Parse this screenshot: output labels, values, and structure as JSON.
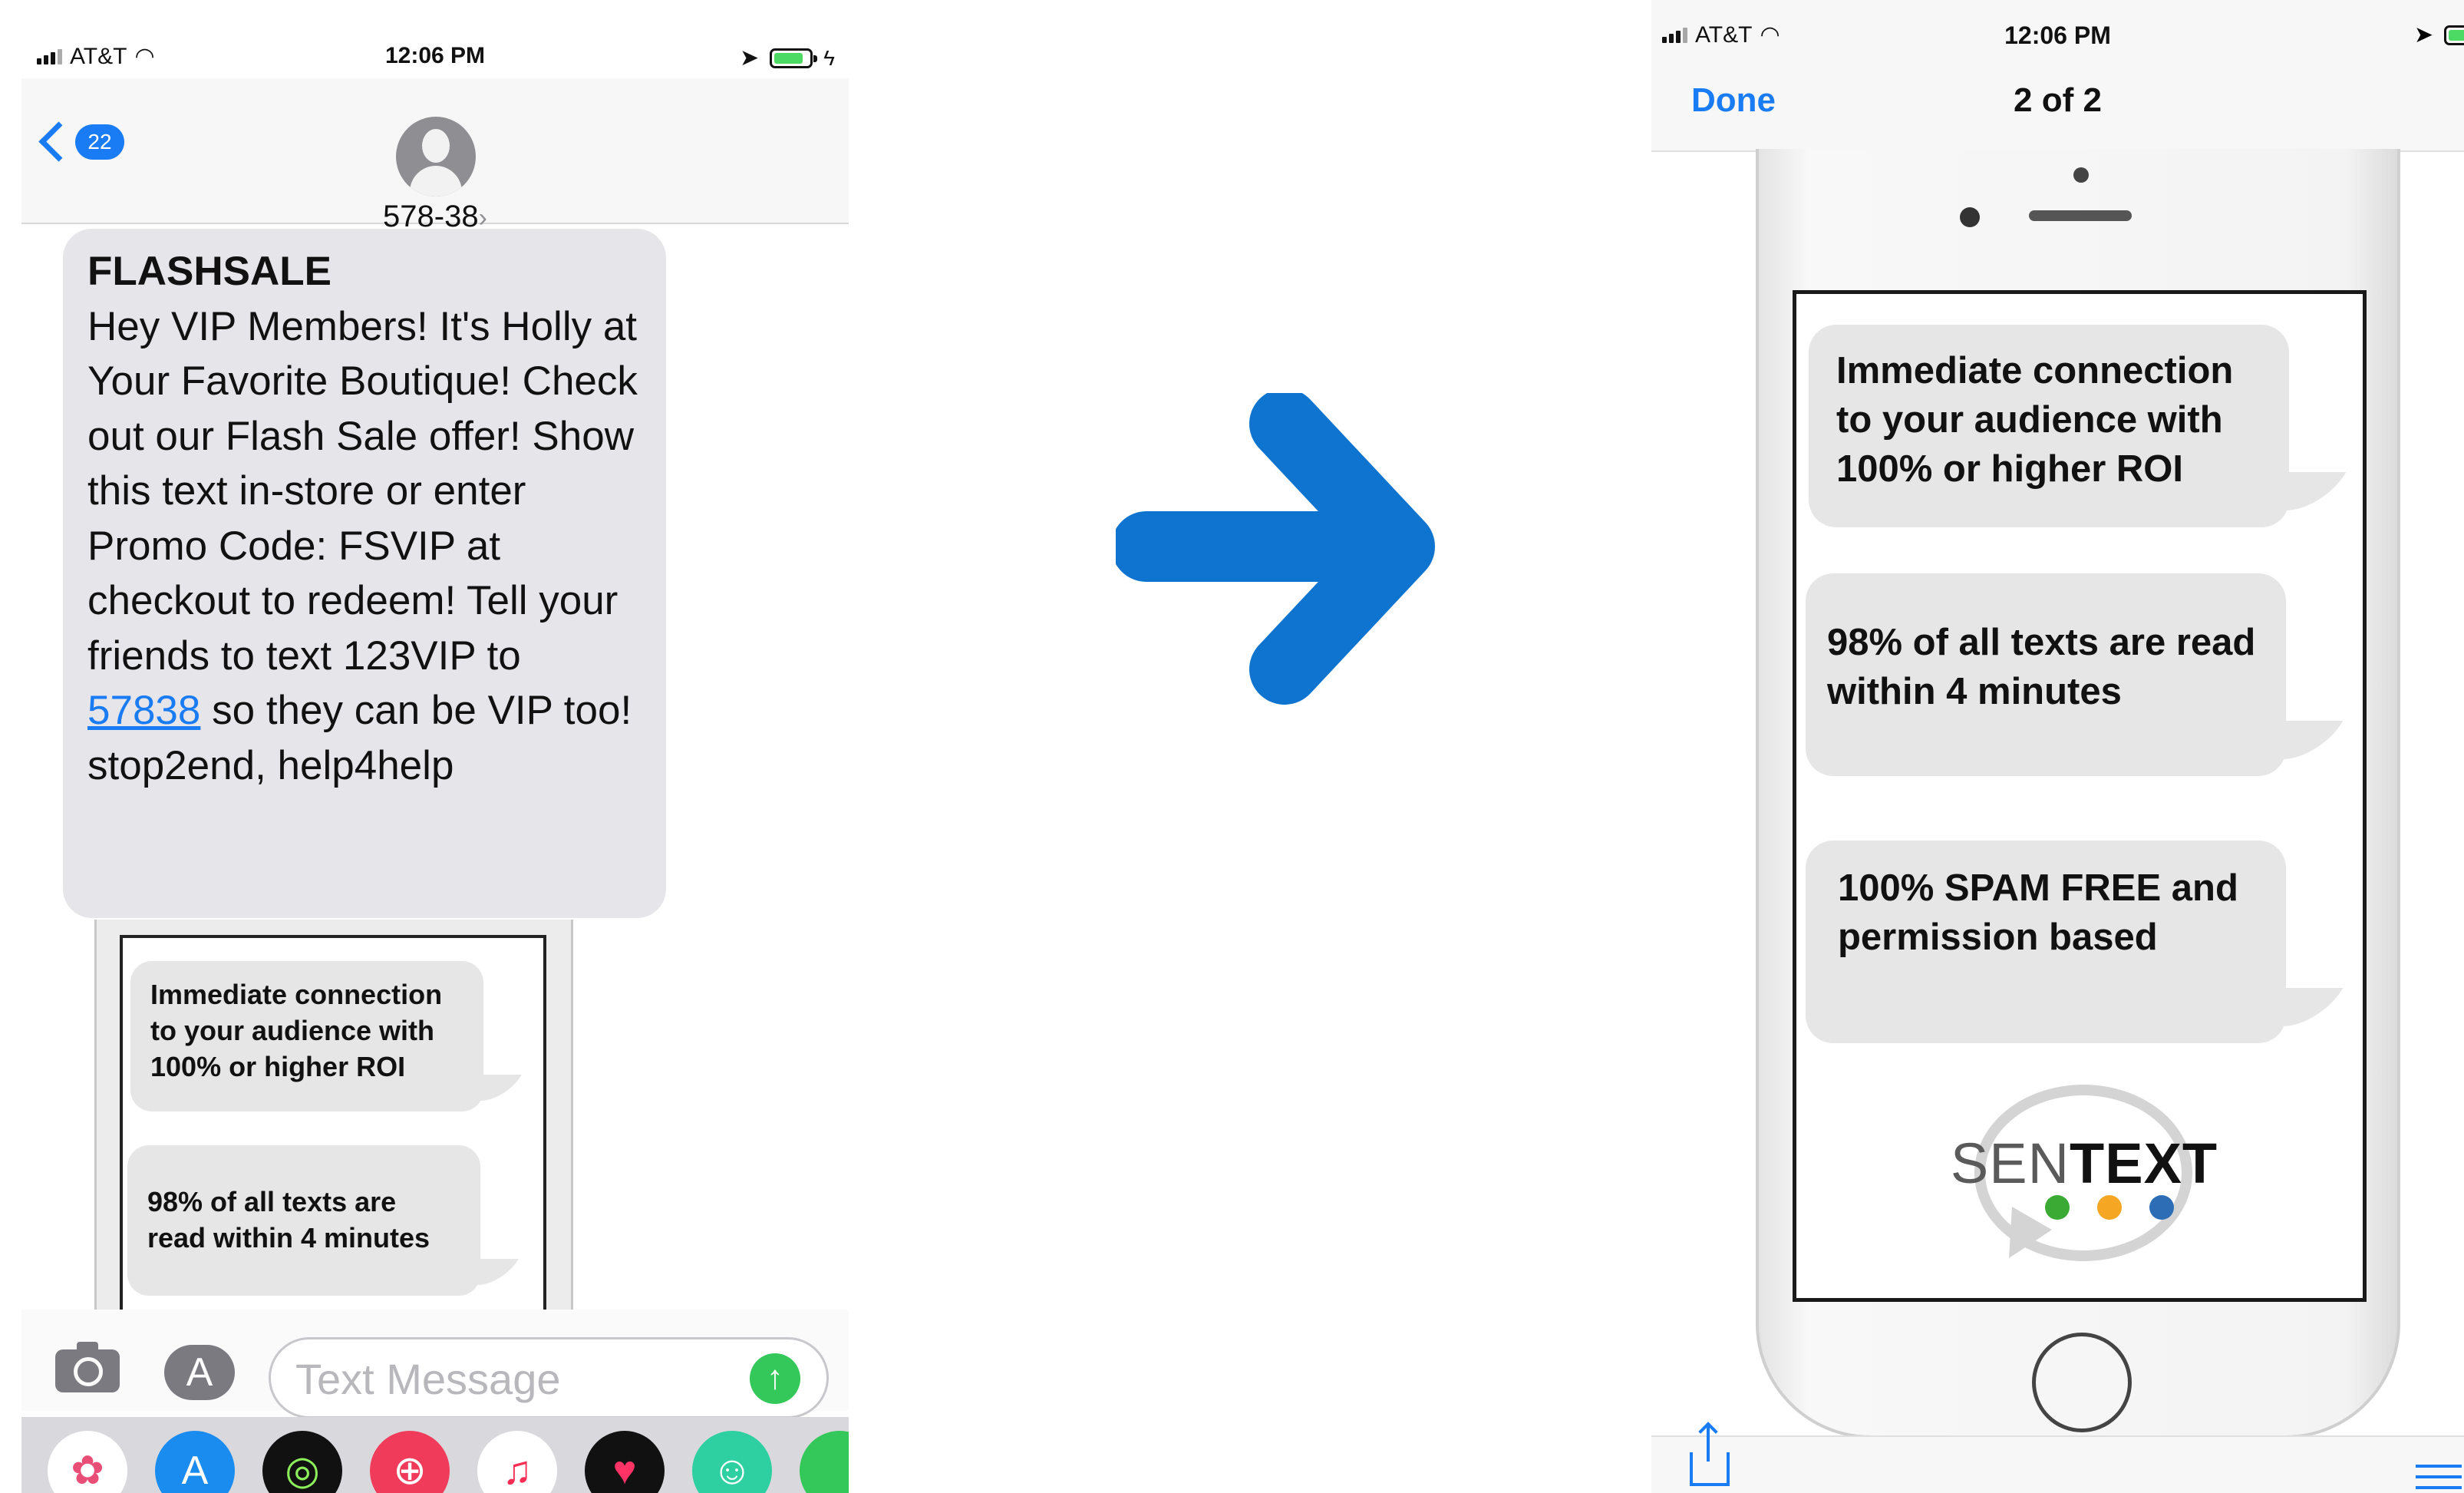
{
  "left": {
    "status": {
      "carrier": "AT&T",
      "time": "12:06 PM",
      "battery_level": 0.85
    },
    "header": {
      "back_badge": "22",
      "contact": "578-38",
      "contact_chevron": "›"
    },
    "message": {
      "title": "FLASHSALE",
      "body_before_link": "Hey VIP Members! It's Holly at Your Favorite Boutique! Check out our Flash Sale offer! Show this text in-store or enter Promo Code: FSVIP at checkout to redeem! Tell your friends to text 123VIP to ",
      "link": "57838",
      "body_after_link": " so they can be VIP too! stop2end, help4help"
    },
    "preview": {
      "bubble1": "Immediate connection to your audience with 100% or higher ROI",
      "bubble2": "98% of all texts are read within 4 minutes"
    },
    "compose": {
      "placeholder": "Text Message",
      "send_glyph": "↑",
      "appstore_glyph": "A"
    },
    "dock": [
      {
        "name": "photos-app-icon",
        "glyph": "✿",
        "bg": "#ffffff",
        "fg": "#e94e77"
      },
      {
        "name": "app-store-icon",
        "glyph": "A",
        "bg": "#1a8cf0",
        "fg": "#ffffff"
      },
      {
        "name": "activity-app-icon",
        "glyph": "◎",
        "bg": "#111111",
        "fg": "#8cf05a"
      },
      {
        "name": "search-globe-icon",
        "glyph": "⊕",
        "bg": "#f03c5a",
        "fg": "#ffffff"
      },
      {
        "name": "music-app-icon",
        "glyph": "♫",
        "bg": "#ffffff",
        "fg": "#fa2d55"
      },
      {
        "name": "heart-app-icon",
        "glyph": "♥",
        "bg": "#111111",
        "fg": "#ff3366"
      },
      {
        "name": "bitmoji-app-icon",
        "glyph": "☺",
        "bg": "#2ecfa0",
        "fg": "#ffffff"
      },
      {
        "name": "partial-app-icon",
        "glyph": "",
        "bg": "#34c759",
        "fg": "#ffffff"
      }
    ]
  },
  "right": {
    "status": {
      "carrier": "AT&T",
      "time": "12:06 PM"
    },
    "nav": {
      "done_label": "Done",
      "counter": "2 of 2"
    },
    "phone": {
      "bubble1": "Immediate connection to your audience with 100% or higher ROI",
      "bubble2": "98% of all texts are read within 4 minutes",
      "bubble3": "100% SPAM FREE and permission based",
      "logo_part1": "SEN",
      "logo_part2": "TEXT",
      "logo_dots": [
        "#3aaa35",
        "#f5a623",
        "#2d6db5"
      ]
    }
  },
  "colors": {
    "ios_blue": "#1a7cf5",
    "arrow_blue": "#0f74cf",
    "bubble_grey": "#e5e5ea",
    "send_green": "#34c759"
  }
}
